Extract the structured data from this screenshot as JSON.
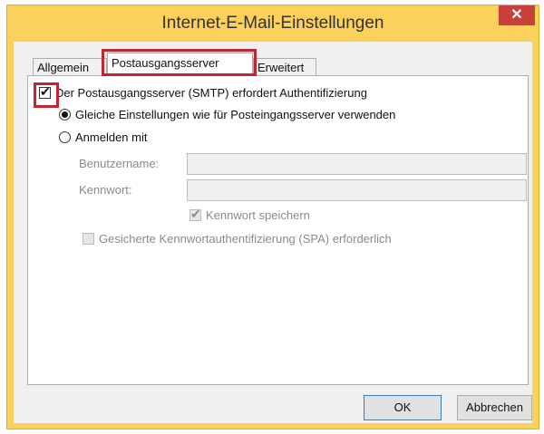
{
  "window": {
    "title": "Internet-E-Mail-Einstellungen",
    "close_label": "✕"
  },
  "tabs": [
    {
      "label": "Allgemein",
      "selected": false
    },
    {
      "label": "Postausgangsserver",
      "selected": true
    },
    {
      "label": "Erweitert",
      "selected": false
    }
  ],
  "smtp_auth": {
    "label": "Der Postausgangsserver (SMTP) erfordert Authentifizierung",
    "checked": true
  },
  "options": {
    "same_settings_label": "Gleiche Einstellungen wie für Posteingangsserver verwenden",
    "same_settings_selected": true,
    "login_with_label": "Anmelden mit",
    "login_with_selected": false
  },
  "credentials": {
    "username_label": "Benutzername:",
    "username_value": "",
    "password_label": "Kennwort:",
    "password_value": "",
    "remember_password_label": "Kennwort speichern",
    "remember_password_checked": true,
    "spa_label": "Gesicherte Kennwortauthentifizierung (SPA) erforderlich",
    "spa_checked": false
  },
  "buttons": {
    "ok_label": "OK",
    "cancel_label": "Abbrechen"
  },
  "colors": {
    "title_bar": "#fbd15b",
    "close_button": "#c7403a",
    "highlight": "#c0262d"
  }
}
